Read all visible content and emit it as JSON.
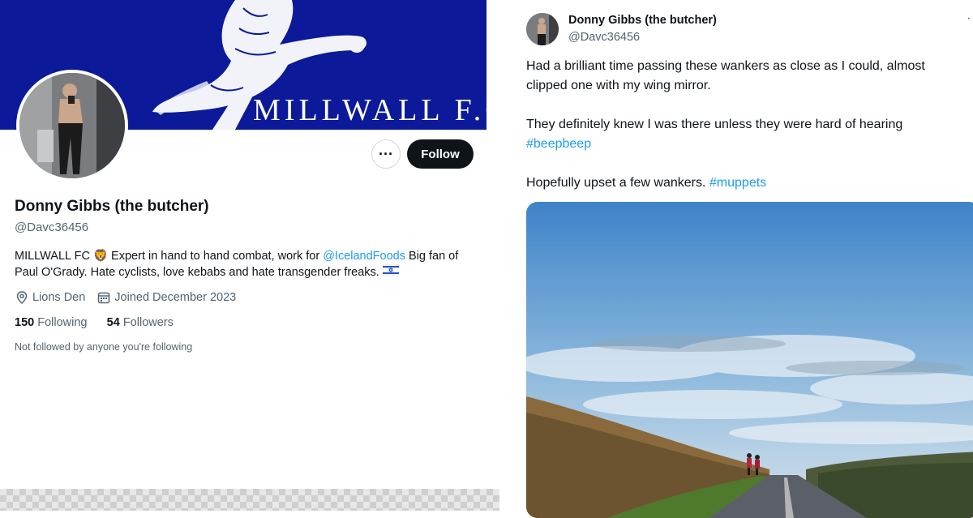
{
  "profile": {
    "banner_text": "MILLWALL F.C.",
    "more_label": "···",
    "follow_label": "Follow",
    "display_name": "Donny Gibbs (the butcher)",
    "handle": "@Davc36456",
    "bio": {
      "part1": "MILLWALL FC",
      "emoji": "🦁",
      "part2": " Expert in hand to hand combat, work for ",
      "mention": "@IcelandFoods",
      "part3": " Big fan of Paul O'Grady. Hate cyclists, love kebabs and hate transgender freaks. ",
      "flag_icon": "israel-flag-icon"
    },
    "location": "Lions Den",
    "location_icon": "location-pin-icon",
    "joined": "Joined December 2023",
    "joined_icon": "calendar-icon",
    "following_count": "150",
    "following_label": "Following",
    "followers_count": "54",
    "followers_label": "Followers",
    "not_followed": "Not followed by anyone you're following"
  },
  "tweet": {
    "display_name": "Donny Gibbs (the butcher)",
    "handle": "@Davc36456",
    "more_icon": "more-dots-icon",
    "line1": "Had a brilliant time passing these wankers as close as I could, almost clipped one with my wing mirror.",
    "line2": "They definitely knew I was there unless they were hard of hearing ",
    "hashtag1": "#beepbeep",
    "line3": "Hopefully upset a few wankers. ",
    "hashtag2": "#muppets"
  },
  "colors": {
    "banner_blue": "#0c1a9a",
    "link_blue": "#1d9bf0",
    "text_dark": "#0f1419",
    "text_muted": "#536471"
  }
}
